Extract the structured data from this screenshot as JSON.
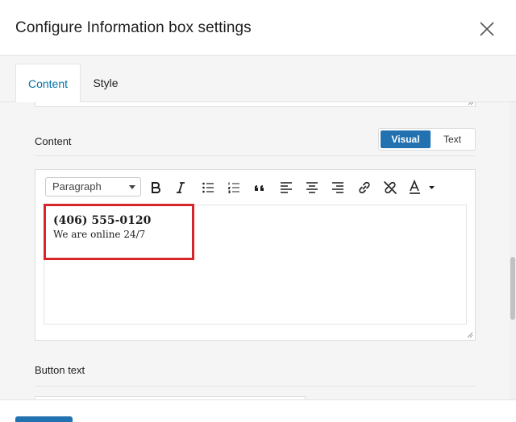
{
  "modal": {
    "title": "Configure Information box settings",
    "close_icon": "close-icon"
  },
  "tabs": [
    {
      "label": "Content",
      "active": true
    },
    {
      "label": "Style",
      "active": false
    }
  ],
  "content_field": {
    "label": "Content",
    "mode_visual": "Visual",
    "mode_text": "Text",
    "active_mode": "Visual"
  },
  "toolbar": {
    "format_select": "Paragraph",
    "buttons": [
      "bold-icon",
      "italic-icon",
      "bullet-list-icon",
      "numbered-list-icon",
      "blockquote-icon",
      "align-left-icon",
      "align-center-icon",
      "align-right-icon",
      "link-icon",
      "unlink-icon",
      "text-color-icon"
    ]
  },
  "editor": {
    "line1": "(406) 555-0120",
    "line2": "We are online 24/7"
  },
  "button_text_field": {
    "label": "Button text"
  },
  "colors": {
    "accent": "#0073aa",
    "primary_button": "#2271b1",
    "highlight": "#d6262b"
  }
}
